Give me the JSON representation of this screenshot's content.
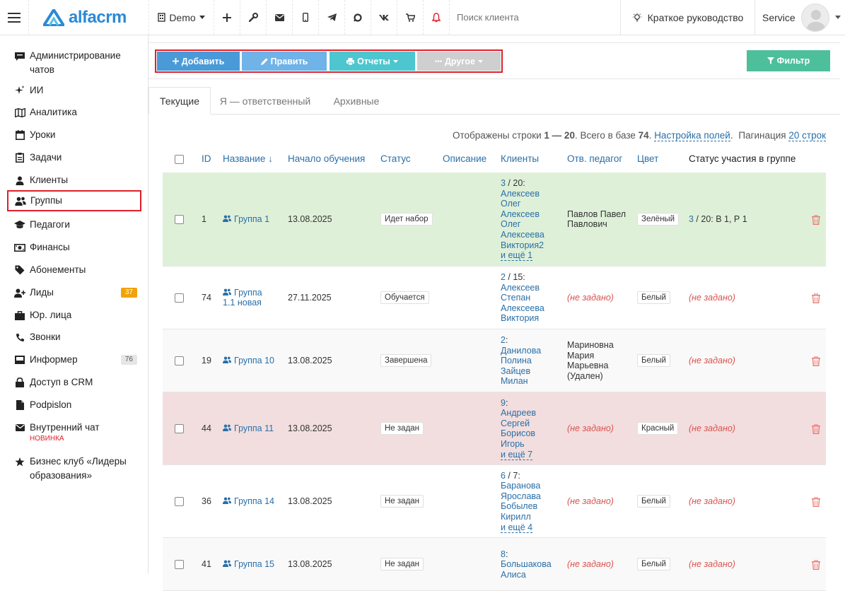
{
  "topbar": {
    "logo_text": "alfacrm",
    "demo_label": "Demo",
    "search_placeholder": "Поиск клиента",
    "guide_label": "Краткое руководство",
    "user_label": "Service"
  },
  "sidebar": {
    "items": [
      {
        "label": "Администрирование чатов",
        "icon": "chat-admin-icon"
      },
      {
        "label": "ИИ",
        "icon": "sparkle-icon"
      },
      {
        "label": "Аналитика",
        "icon": "map-icon"
      },
      {
        "label": "Уроки",
        "icon": "calendar-icon"
      },
      {
        "label": "Задачи",
        "icon": "clipboard-icon"
      },
      {
        "label": "Клиенты",
        "icon": "user-icon"
      },
      {
        "label": "Группы",
        "icon": "users-icon",
        "active": true
      },
      {
        "label": "Педагоги",
        "icon": "graduation-cap-icon"
      },
      {
        "label": "Финансы",
        "icon": "money-icon"
      },
      {
        "label": "Абонементы",
        "icon": "tag-icon"
      },
      {
        "label": "Лиды",
        "icon": "user-plus-icon",
        "badge": "37"
      },
      {
        "label": "Юр. лица",
        "icon": "briefcase-icon"
      },
      {
        "label": "Звонки",
        "icon": "phone-icon"
      },
      {
        "label": "Информер",
        "icon": "inbox-icon",
        "badge": "76"
      },
      {
        "label": "Доступ в CRM",
        "icon": "lock-icon"
      },
      {
        "label": "Podpislon",
        "icon": "document-icon"
      },
      {
        "label": "Внутренний чат",
        "icon": "envelope-icon",
        "tag": "НОВИНКА"
      },
      {
        "label": "Бизнес клуб «Лидеры образования»",
        "icon": "star-icon"
      }
    ]
  },
  "toolbar": {
    "add": "Добавить",
    "edit": "Править",
    "reports": "Отчеты",
    "other": "Другое",
    "filter": "Фильтр"
  },
  "tabs": [
    "Текущие",
    "Я — ответственный",
    "Архивные"
  ],
  "info": {
    "prefix": "Отображены строки",
    "range": "1 — 20",
    "total_prefix": "Всего в базе",
    "total": "74",
    "settings_link": "Настройка полей",
    "pagination_label": "Пагинация",
    "pagination_value": "20 строк"
  },
  "table": {
    "headers": {
      "id": "ID",
      "name": "Название ↓",
      "start": "Начало обучения",
      "status": "Статус",
      "desc": "Описание",
      "clients": "Клиенты",
      "teacher": "Отв. педагог",
      "color": "Цвет",
      "participation": "Статус участия в группе"
    },
    "rows": [
      {
        "id": "1",
        "name": [
          "Группа 1"
        ],
        "start": "13.08.2025",
        "status": "Идет набор",
        "clients_count": "3",
        "clients_total": " / 20:",
        "clients": [
          "Алексеев",
          "Олег",
          "Алексеев",
          "Олег",
          "Алексеева",
          "Виктория2"
        ],
        "more": "и ещё 1",
        "teacher": [
          "Павлов Павел",
          "Павлович"
        ],
        "color": "Зелёный",
        "participation_count": "3",
        "participation_rest": " / 20:  В 1, Р 1"
      },
      {
        "id": "74",
        "name": [
          "Группа",
          "1.1 новая"
        ],
        "start": "27.11.2025",
        "status": "Обучается",
        "clients_count": "2",
        "clients_total": " / 15:",
        "clients": [
          "Алексеев",
          "Степан",
          "Алексеева",
          "Виктория"
        ],
        "more": "",
        "teacher_notset": "(не задано)",
        "color": "Белый",
        "participation_notset": "(не задано)"
      },
      {
        "id": "19",
        "name": [
          "Группа 10"
        ],
        "start": "13.08.2025",
        "status": "Завершена",
        "clients_count": "2",
        "clients_total": ":",
        "clients": [
          "Данилова",
          "Полина",
          "Зайцев",
          "Милан"
        ],
        "more": "",
        "teacher": [
          "Мариновна",
          "Мария",
          "Марьевна",
          "(Удален)"
        ],
        "color": "Белый",
        "participation_notset": "(не задано)"
      },
      {
        "id": "44",
        "name": [
          "Группа 11"
        ],
        "start": "13.08.2025",
        "status": "Не задан",
        "clients_count": "9",
        "clients_total": ":",
        "clients": [
          "Андреев",
          "Сергей",
          "Борисов",
          "Игорь"
        ],
        "more": "и ещё 7",
        "teacher_notset": "(не задано)",
        "color": "Красный",
        "participation_notset": "(не задано)"
      },
      {
        "id": "36",
        "name": [
          "Группа 14"
        ],
        "start": "13.08.2025",
        "status": "Не задан",
        "clients_count": "6",
        "clients_total": " / 7:",
        "clients": [
          "Баранова",
          "Ярослава",
          "Бобылев",
          "Кирилл"
        ],
        "more": "и ещё 4",
        "teacher_notset": "(не задано)",
        "color": "Белый",
        "participation_notset": "(не задано)"
      },
      {
        "id": "41",
        "name": [
          "Группа 15"
        ],
        "start": "13.08.2025",
        "status": "Не задан",
        "clients_count": "8",
        "clients_total": ":",
        "clients": [
          "Большакова",
          "Алиса"
        ],
        "more": "",
        "teacher_notset": "(не задано)",
        "color": "Белый",
        "participation_notset": "(не задано)"
      }
    ]
  },
  "colors": {
    "accent_red": "#e0202a",
    "add_btn": "#4a9ad8",
    "edit_btn": "#6fb3e8",
    "reports_btn": "#4ec6d0",
    "other_btn": "#cfcfcf",
    "filter_btn": "#4dbf9b",
    "row_green": "#dff0d8",
    "row_red": "#f2dede",
    "link": "#2a6fa8"
  }
}
